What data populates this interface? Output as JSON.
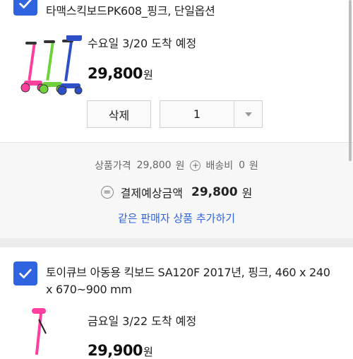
{
  "items": [
    {
      "title": "타맥스킥보드PK608_핑크, 단일옵션",
      "delivery": "수요일 3/20 도착 예정",
      "price": "29,800",
      "price_unit": "원",
      "delete_label": "삭제",
      "quantity": "1"
    },
    {
      "title_line1": "토이큐브 아동용 킥보드 SA120F 2017년, 핑크, 460 x 240",
      "title_line2": "x 670~900 mm",
      "delivery": "금요일 3/22 도착 예정",
      "price": "29,900",
      "price_unit": "원"
    }
  ],
  "summary": {
    "product_price_label": "상품가격",
    "product_price": "29,800",
    "won": "원",
    "plus": "+",
    "shipping_label": "배송비",
    "shipping": "0",
    "equals": "=",
    "total_label": "결제예상금액",
    "total": "29,800",
    "add_link": "같은 판매자 상품 추가하기"
  },
  "colors": {
    "accent": "#2f63e0",
    "summary_bg": "#f7f7f8"
  },
  "icons": [
    "checkmark-icon",
    "dropdown-arrow-icon",
    "plus-circle-icon",
    "equals-circle-icon"
  ]
}
